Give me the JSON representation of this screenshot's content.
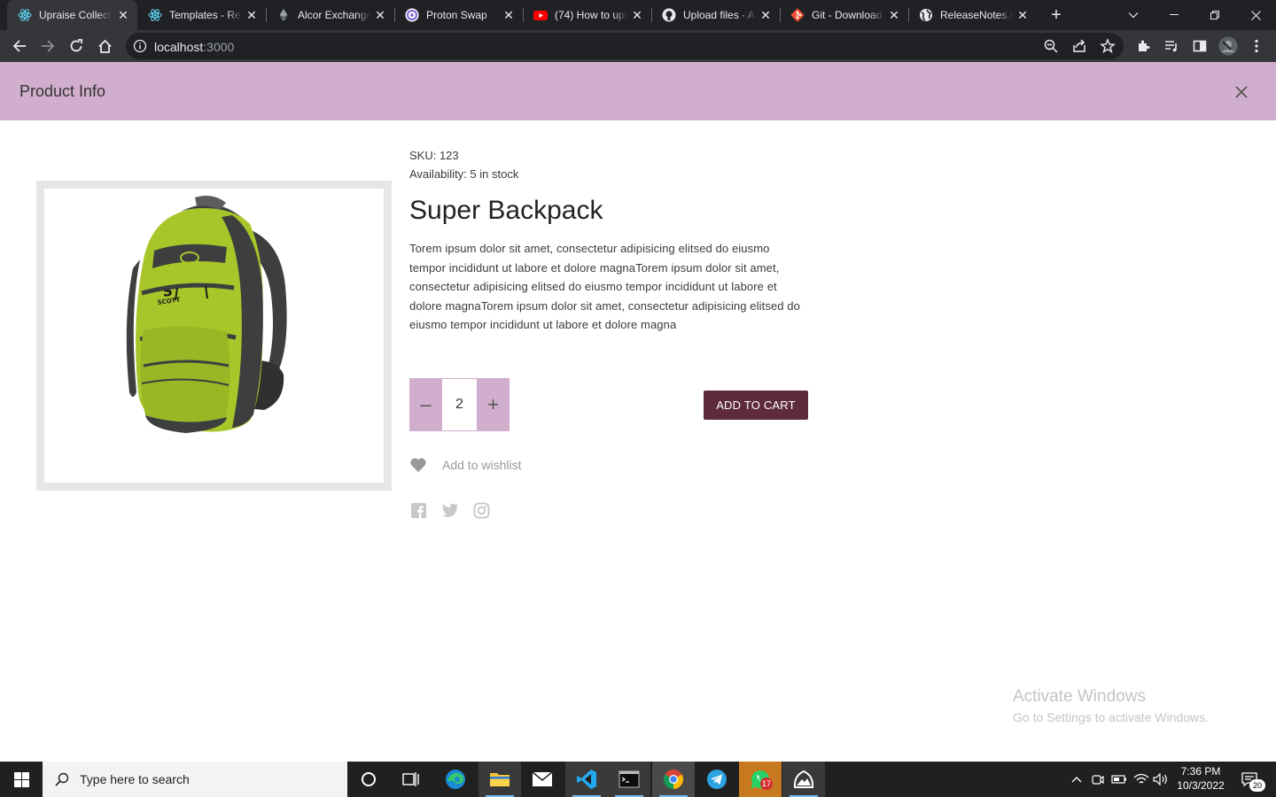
{
  "browser": {
    "tabs": [
      {
        "title": "Upraise Collecti",
        "icon": "react-icon",
        "active": true
      },
      {
        "title": "Templates - Rea",
        "icon": "react-icon"
      },
      {
        "title": "Alcor Exchange",
        "icon": "ethereum-icon"
      },
      {
        "title": "Proton Swap",
        "icon": "proton-icon"
      },
      {
        "title": "(74) How to upl",
        "icon": "youtube-icon"
      },
      {
        "title": "Upload files · A",
        "icon": "github-icon"
      },
      {
        "title": "Git - Download",
        "icon": "git-icon"
      },
      {
        "title": "ReleaseNotes.h",
        "icon": "globe-icon"
      }
    ],
    "address": {
      "host": "localhost",
      "port": ":3000"
    }
  },
  "appbar": {
    "title": "Product Info"
  },
  "product": {
    "sku": "SKU: 123",
    "availability": "Availability: 5 in stock",
    "name": "Super Backpack",
    "description": "Torem ipsum dolor sit amet, consectetur adipisicing elitsed do eiusmo tempor incididunt ut labore et dolore magnaTorem ipsum dolor sit amet, consectetur adipisicing elitsed do eiusmo tempor incididunt ut labore et dolore magnaTorem ipsum dolor sit amet, consectetur adipisicing elitsed do eiusmo tempor incididunt ut labore et dolore magna",
    "quantity": "2",
    "decrement": "–",
    "increment": "+",
    "add_to_cart": "ADD TO CART",
    "wishlist": "Add to wishlist"
  },
  "watermark": {
    "line1": "Activate Windows",
    "line2": "Go to Settings to activate Windows."
  },
  "taskbar": {
    "search_placeholder": "Type here to search",
    "time": "7:36 PM",
    "date": "10/3/2022",
    "whatsapp_badge": "17",
    "notifications": "20"
  },
  "colors": {
    "accent": "#d1aecd",
    "cart": "#5d2b3c"
  }
}
